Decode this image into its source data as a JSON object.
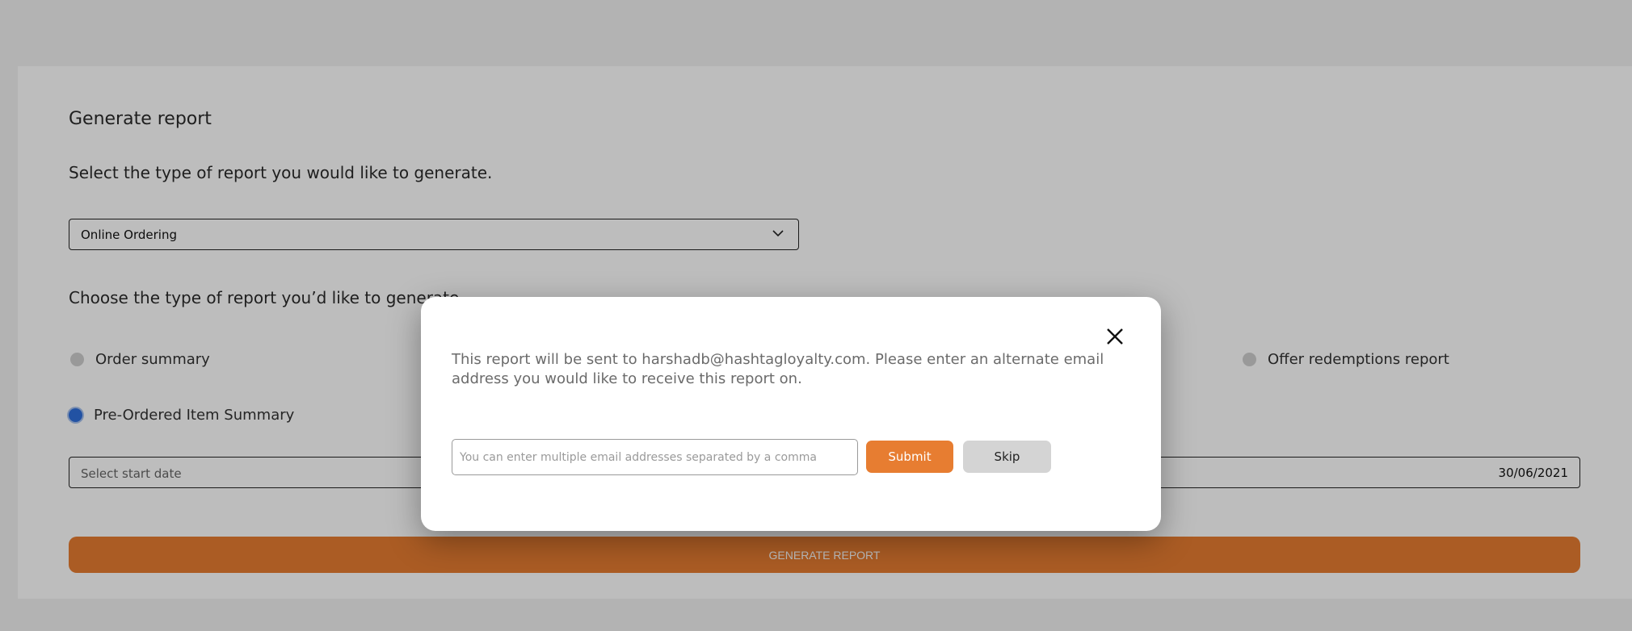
{
  "page": {
    "title": "Generate report",
    "report_type_prompt": "Select the type of report you would like to generate.",
    "report_type_select": {
      "value": "Online Ordering"
    },
    "choose_prompt": "Choose the type of report you’d like to generate.",
    "radios": [
      {
        "label": "Order summary",
        "selected": false
      },
      {
        "label": "Offer redemptions report",
        "selected": false
      },
      {
        "label": "Pre-Ordered Item Summary",
        "selected": true
      }
    ],
    "start_date": {
      "placeholder": "Select start date"
    },
    "end_date": {
      "value": "30/06/2021"
    },
    "generate_button": "GENERATE REPORT"
  },
  "modal": {
    "message": "This report will be sent to harshadb@hashtagloyalty.com. Please enter an alternate email address you would like to receive this report on.",
    "email_input": {
      "placeholder": "You can enter multiple email addresses separated by a comma",
      "value": ""
    },
    "submit_label": "Submit",
    "skip_label": "Skip"
  },
  "colors": {
    "accent": "#e77d31",
    "selected_radio": "#2f6fdc",
    "skip_bg": "#d4d4d4"
  }
}
